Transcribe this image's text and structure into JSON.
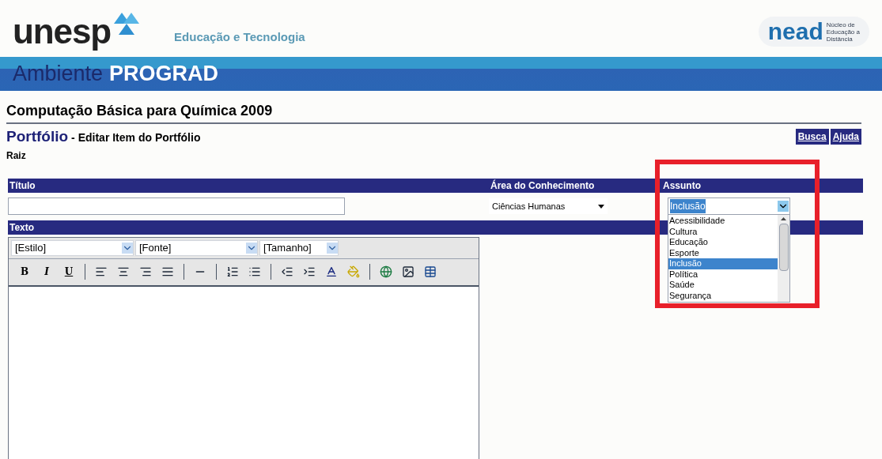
{
  "header": {
    "logo": "unesp",
    "tagline": "Educação e Tecnologia",
    "partner_logo": "nead",
    "partner_caption": [
      "Núcleo de",
      "Educação a",
      "Distância"
    ]
  },
  "banner": {
    "prefix": "Ambiente",
    "name": "PROGRAD"
  },
  "course_title": "Computação Básica para Química 2009",
  "page": {
    "section": "Portfólio",
    "subtitle": "- Editar Item do Portfólio",
    "breadcrumb": "Raiz"
  },
  "top_links": [
    "Busca",
    "Ajuda"
  ],
  "form": {
    "title_label": "Título",
    "area_label": "Área do Conhecimento",
    "area_value": "Ciências Humanas",
    "subject_label": "Assunto",
    "subject_value": "Inclusão",
    "text_label": "Texto",
    "subject_options": [
      {
        "label": "Acessibilidade",
        "selected": false
      },
      {
        "label": "Cultura",
        "selected": false
      },
      {
        "label": "Educação",
        "selected": false
      },
      {
        "label": "Esporte",
        "selected": false
      },
      {
        "label": "Inclusão",
        "selected": true
      },
      {
        "label": "Política",
        "selected": false
      },
      {
        "label": "Saúde",
        "selected": false
      },
      {
        "label": "Segurança",
        "selected": false
      }
    ]
  },
  "editor": {
    "dropdowns": [
      "[Estilo]",
      "[Fonte]",
      "[Tamanho]"
    ],
    "format_buttons": [
      "B",
      "I",
      "U"
    ]
  },
  "highlight": {
    "on": true
  }
}
